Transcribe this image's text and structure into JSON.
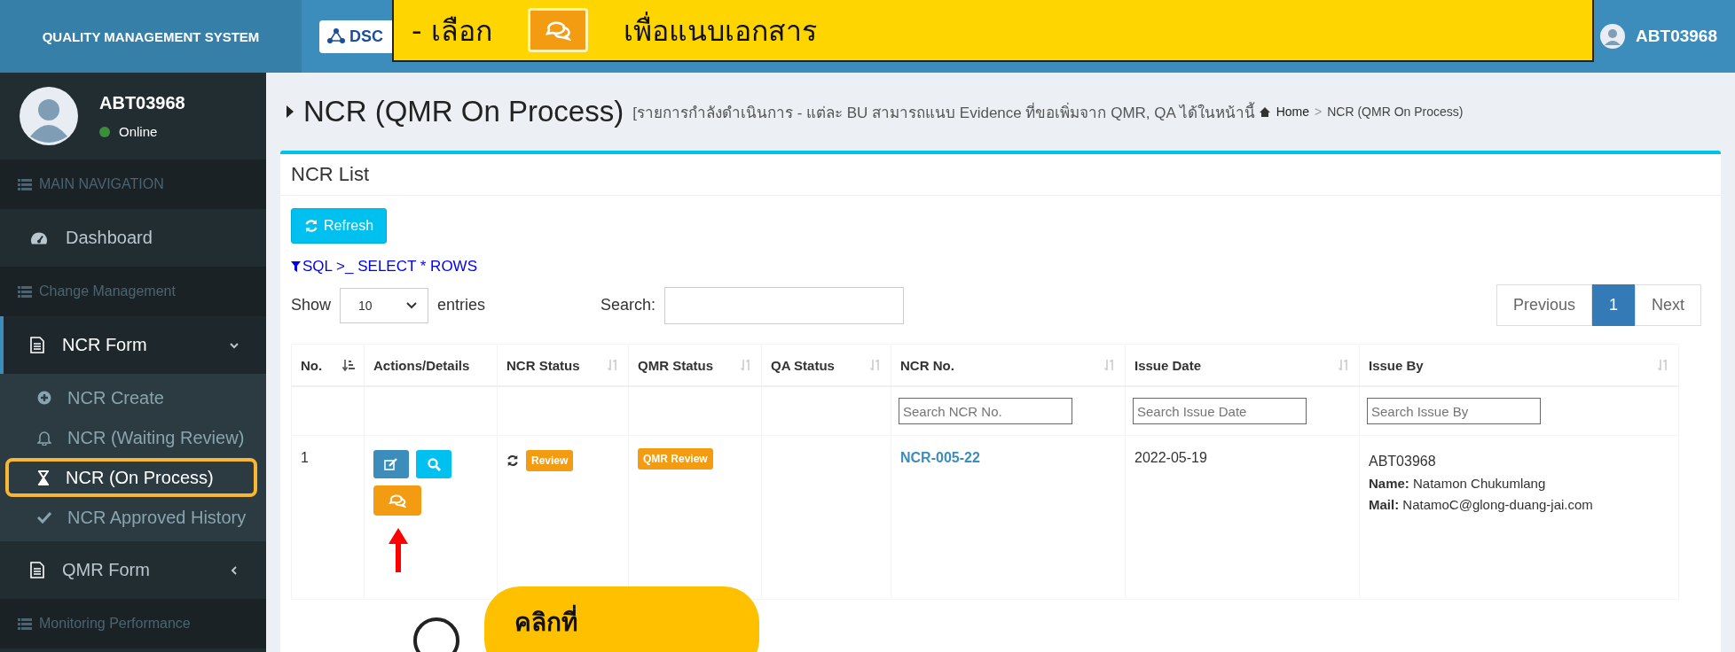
{
  "top_bar": {
    "brand": "QUALITY MANAGEMENT SYSTEM",
    "logo_text": "DSC",
    "user": "ABT03968"
  },
  "callout_top": {
    "before": "- เลือก",
    "after": "เพื่อแนบเอกสาร"
  },
  "sidebar": {
    "user": {
      "name": "ABT03968",
      "status": "Online",
      "color": "#3c8d3c"
    },
    "nav": [
      {
        "kind": "header",
        "label": "MAIN NAVIGATION"
      },
      {
        "kind": "link",
        "label": "Dashboard"
      },
      {
        "kind": "header",
        "label": "Change Management"
      },
      {
        "kind": "group",
        "label": "NCR Form",
        "expanded": true,
        "children": [
          {
            "label": "NCR Create",
            "selected": false
          },
          {
            "label": "NCR (Waiting Review)",
            "selected": false
          },
          {
            "label": "NCR (On Process)",
            "selected": true
          },
          {
            "label": "NCR Approved History",
            "selected": false
          }
        ]
      },
      {
        "kind": "group",
        "label": "QMR Form",
        "expanded": false
      },
      {
        "kind": "header",
        "label": "Monitoring Performance"
      }
    ]
  },
  "page": {
    "title": "NCR (QMR On Process)",
    "subtitle": "[รายการกำลังดำเนินการ - แต่ละ BU สามารถแนบ Evidence ที่ขอเพิ่มจาก QMR, QA ได้ในหน้านี้",
    "breadcrumb": [
      "Home",
      "NCR (QMR On Process)"
    ],
    "breadcrumb_separator": ">"
  },
  "panel": {
    "title": "NCR List",
    "refresh": "Refresh",
    "sql_link": "SQL >_ SELECT * ROWS",
    "show_label": "Show",
    "page_size": "10",
    "entries_label": "entries",
    "search_label": "Search:",
    "pagination": [
      {
        "label": "Previous",
        "selected": false
      },
      {
        "label": "1",
        "selected": true
      },
      {
        "label": "Next",
        "selected": false
      }
    ]
  },
  "table": {
    "columns": [
      {
        "label": "No.",
        "sorted": true
      },
      {
        "label": "Actions/Details"
      },
      {
        "label": "NCR Status",
        "sorted": false
      },
      {
        "label": "QMR Status",
        "sorted": false
      },
      {
        "label": "QA Status",
        "sorted": false
      },
      {
        "label": "NCR No.",
        "sorted": false,
        "filter_placeholder": "Search NCR No."
      },
      {
        "label": "Issue Date",
        "sorted": false,
        "filter_placeholder": "Search Issue Date"
      },
      {
        "label": "Issue By",
        "sorted": false,
        "filter_placeholder": "Search Issue By"
      }
    ],
    "rows": [
      {
        "no": "1",
        "ncr_status": "Review",
        "qmr_status": "QMR Review",
        "ncr_no": "NCR-005-22",
        "issue_date": "2022-05-19",
        "issue_by": {
          "id": "ABT03968",
          "name_label": "Name:",
          "name": "Natamon Chukumlang",
          "mail_label": "Mail:",
          "mail": "NatamoC@glong-duang-jai.com"
        }
      }
    ]
  },
  "callout_bottom": {
    "text": "คลิกที่"
  }
}
